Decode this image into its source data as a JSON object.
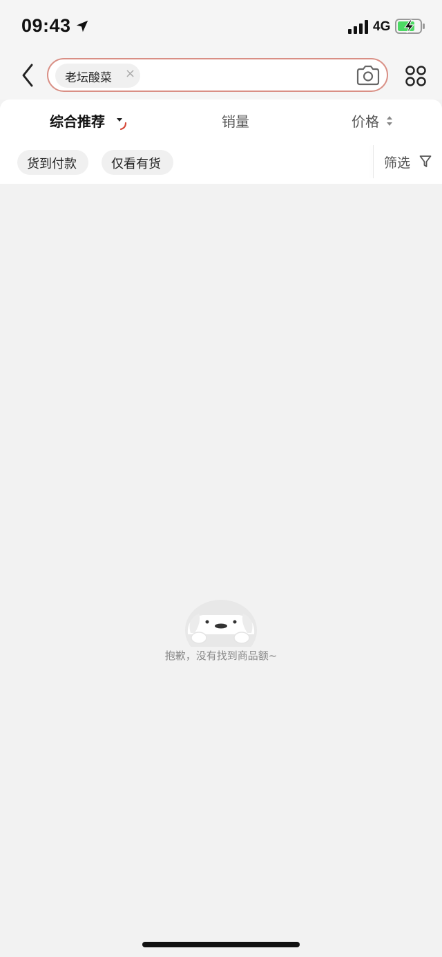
{
  "status_bar": {
    "time": "09:43",
    "network": "4G",
    "icons": [
      "location-arrow-icon",
      "signal-bars-icon",
      "battery-charging-icon"
    ]
  },
  "search": {
    "query_chip": "老坛酸菜",
    "chip_close": "×",
    "icons": [
      "back-icon",
      "camera-icon",
      "grid-menu-icon"
    ],
    "accent_color": "#d98f85"
  },
  "sort": {
    "tabs": [
      {
        "label": "综合推荐",
        "active": true
      },
      {
        "label": "销量",
        "active": false
      },
      {
        "label": "价格",
        "active": false
      }
    ]
  },
  "filters": {
    "chips": [
      "货到付款",
      "仅看有货"
    ],
    "filter_label": "筛选"
  },
  "empty_state": {
    "message": "抱歉，没有找到商品额~"
  }
}
